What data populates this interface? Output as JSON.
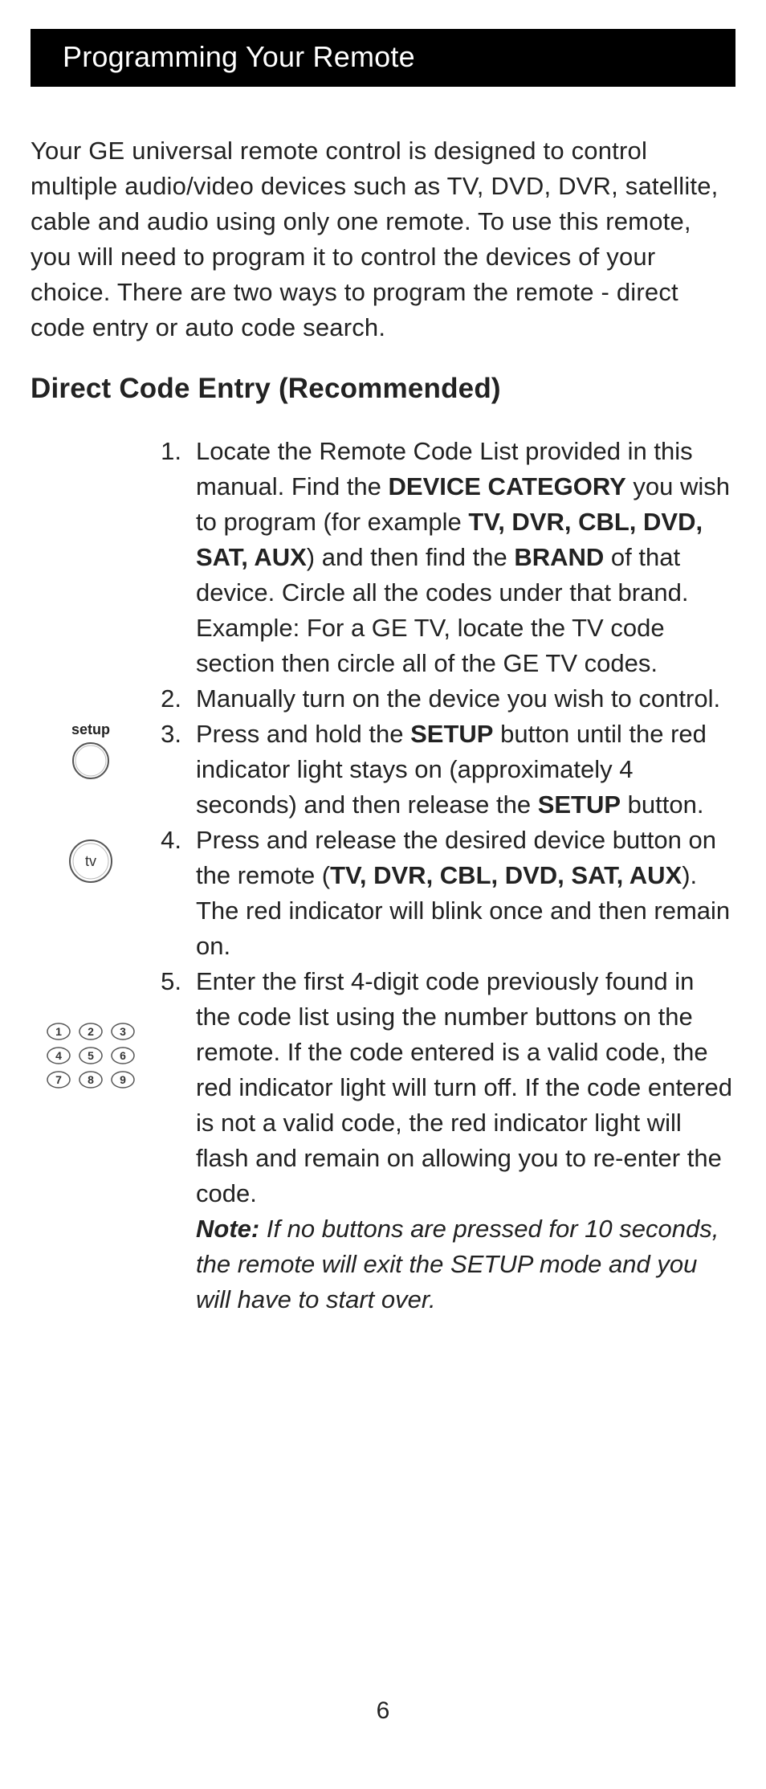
{
  "title": "Programming Your Remote",
  "intro": "Your GE universal remote control is designed to control multiple audio/video devices such as TV, DVD, DVR, satellite, cable and audio using only one remote. To use this remote, you will need to program it to control the devices of your choice. There are two ways to program the remote - direct code entry or auto code search.",
  "section_heading": "Direct Code Entry (Recommended)",
  "steps": {
    "s1": {
      "num": "1.",
      "t1": "Locate the Remote Code List provided in this manual. Find the ",
      "b1": "DEVICE CATEGORY",
      "t2": " you wish to program (for example ",
      "b2": "TV, DVR, CBL, DVD, SAT, AUX",
      "t3": ") and then find the ",
      "b3": "BRAND",
      "t4": " of that device. Circle all the codes under that brand. Example: For a GE TV, locate the TV code section then circle all of the GE TV codes."
    },
    "s2": {
      "num": "2.",
      "t1": "Manually turn on the device you wish to control."
    },
    "s3": {
      "num": "3.",
      "t1": "Press and hold the ",
      "b1": "SETUP",
      "t2": " button until the red indicator light stays on (approximately 4 seconds) and then release the ",
      "b2": "SETUP",
      "t3": " button."
    },
    "s4": {
      "num": "4.",
      "t1": "Press and release the desired device button on the remote (",
      "b1": "TV, DVR, CBL, DVD, SAT, AUX",
      "t2": "). The red indicator will blink once and then remain on."
    },
    "s5": {
      "num": "5.",
      "t1": "Enter the first 4-digit code previously found in the code list using the number buttons on the remote. If the code entered is a valid code, the red indicator light will turn off. If the code entered is not a valid code, the red indicator light will flash and remain on allowing you to re-enter the code."
    },
    "note": {
      "label": "Note:",
      "text": " If no buttons are pressed for 10 seconds, the remote will exit the SETUP mode and you will have to start over."
    }
  },
  "icons": {
    "setup_label": "setup",
    "tv_label": "tv",
    "keypad": [
      "1",
      "2",
      "3",
      "4",
      "5",
      "6",
      "7",
      "8",
      "9"
    ]
  },
  "page_number": "6"
}
